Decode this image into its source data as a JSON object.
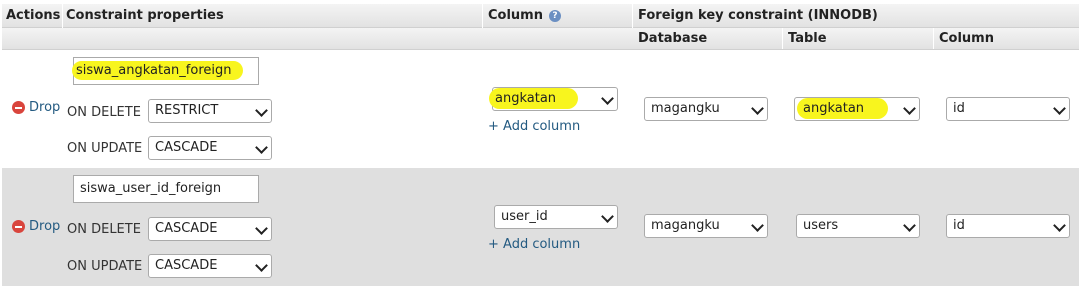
{
  "header": {
    "actions": "Actions",
    "constraint_properties": "Constraint properties",
    "column": "Column",
    "column_help_icon": "help-icon",
    "foreign_key": "Foreign key constraint (INNODB)",
    "database": "Database",
    "table": "Table",
    "ref_column": "Column"
  },
  "colors": {
    "highlight": "#f8f51e",
    "link": "#235a81",
    "drop_icon": "#d9453d",
    "row_alt": "#dfdfdf"
  },
  "rows": [
    {
      "drop_label": "Drop",
      "constraint_name": "siswa_angkatan_foreign",
      "on_delete_label": "ON DELETE",
      "on_delete_value": "RESTRICT",
      "on_update_label": "ON UPDATE",
      "on_update_value": "CASCADE",
      "column_value": "angkatan",
      "add_column_label": "+ Add column",
      "database_value": "magangku",
      "table_value": "angkatan",
      "ref_column_value": "id"
    },
    {
      "drop_label": "Drop",
      "constraint_name": "siswa_user_id_foreign",
      "on_delete_label": "ON DELETE",
      "on_delete_value": "CASCADE",
      "on_update_label": "ON UPDATE",
      "on_update_value": "CASCADE",
      "column_value": "user_id",
      "add_column_label": "+ Add column",
      "database_value": "magangku",
      "table_value": "users",
      "ref_column_value": "id"
    }
  ]
}
